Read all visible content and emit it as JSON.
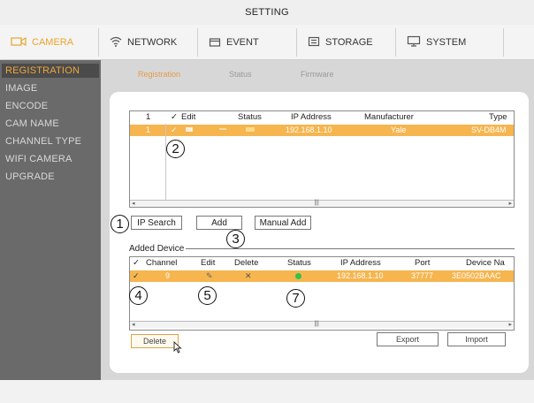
{
  "header": {
    "title": "SETTING"
  },
  "tabs": [
    {
      "label": "CAMERA",
      "icon": "camera-icon",
      "active": true
    },
    {
      "label": "NETWORK",
      "icon": "wifi-icon"
    },
    {
      "label": "EVENT",
      "icon": "event-icon"
    },
    {
      "label": "STORAGE",
      "icon": "storage-icon"
    },
    {
      "label": "SYSTEM",
      "icon": "monitor-icon"
    }
  ],
  "sidebar": {
    "items": [
      {
        "label": "REGISTRATION",
        "active": true
      },
      {
        "label": "IMAGE"
      },
      {
        "label": "ENCODE"
      },
      {
        "label": "CAM NAME"
      },
      {
        "label": "CHANNEL TYPE"
      },
      {
        "label": "WIFI CAMERA"
      },
      {
        "label": "UPGRADE"
      }
    ]
  },
  "subtabs": [
    {
      "label": "Registration",
      "active": true
    },
    {
      "label": "Status"
    },
    {
      "label": "Firmware"
    }
  ],
  "search_table": {
    "headers": [
      "1",
      "✓",
      "Edit",
      "Status",
      "IP Address",
      "Manufacturer",
      "Type"
    ],
    "rows": [
      {
        "num": "1",
        "check": "✓",
        "edit": "",
        "status": "",
        "ip": "192.168.1.10",
        "manufacturer": "Yale",
        "type": "SV-DB4M"
      }
    ]
  },
  "buttons": {
    "ip_search": "IP Search",
    "add": "Add",
    "manual_add": "Manual Add",
    "delete": "Delete",
    "export": "Export",
    "import": "Import"
  },
  "added_device": {
    "title": "Added Device",
    "headers": [
      "✓",
      "Channel",
      "Edit",
      "Delete",
      "Status",
      "IP Address",
      "Port",
      "Device Na"
    ],
    "rows": [
      {
        "check": "✓",
        "channel": "9",
        "edit": "✎",
        "delete": "✕",
        "status": "online",
        "ip": "192.168.1.10",
        "port": "37777",
        "device_name": "3E0502BAAC"
      }
    ]
  },
  "callouts": [
    "1",
    "2",
    "3",
    "4",
    "5",
    "7"
  ],
  "colors": {
    "accent": "#f6b54f",
    "active_text": "#e8a52b",
    "sidebar_bg": "#6a6a6a",
    "status_green": "#33c24a"
  }
}
